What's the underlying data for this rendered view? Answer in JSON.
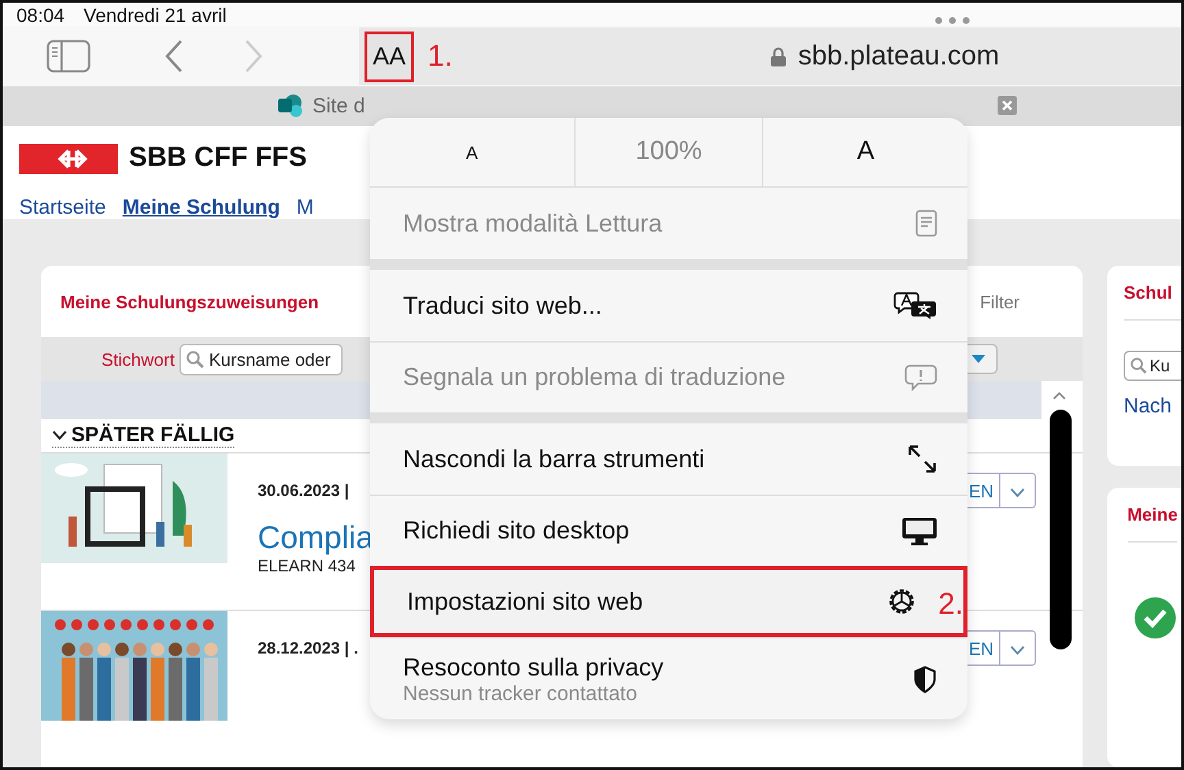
{
  "status_bar": {
    "time": "08:04",
    "date": "Vendredi 21 avril"
  },
  "toolbar": {
    "text_size_button": {
      "label": "AA",
      "annotation": "1.",
      "highlighted": true
    },
    "address": "sbb.plateau.com"
  },
  "tab": {
    "title": "Site d"
  },
  "site": {
    "logo": "SBB CFF FFS",
    "nav": [
      {
        "label": "Startseite",
        "selected": false
      },
      {
        "label": "Meine Schulung",
        "selected": true
      },
      {
        "label": "M",
        "selected": false
      }
    ]
  },
  "assignments": {
    "title": "Meine Schulungszuweisungen",
    "filter": "Filter",
    "keyword_label": "Stichwort",
    "search_placeholder": "Kursname oder",
    "section": "SPÄTER FÄLLIG",
    "courses": [
      {
        "date": "30.06.2023 |",
        "title": "Complia",
        "code": "ELEARN 434",
        "action": "EN"
      },
      {
        "date": "28.12.2023 | .",
        "action": "EN"
      }
    ]
  },
  "side_panels": [
    {
      "kind": "search",
      "title": "Schul",
      "search_placeholder": "Ku",
      "link": "Nach"
    },
    {
      "kind": "status",
      "title": "Meine"
    }
  ],
  "menu": {
    "text_size": {
      "smaller": "A",
      "zoom": "100%",
      "larger": "A"
    },
    "groups": [
      [
        {
          "label": "Mostra modalità Lettura",
          "disabled": true,
          "highlighted": false
        }
      ],
      [
        {
          "label": "Traduci sito web...",
          "disabled": false,
          "highlighted": false
        },
        {
          "label": "Segnala un problema di traduzione",
          "disabled": true,
          "highlighted": false
        }
      ],
      [
        {
          "label": "Nascondi la barra strumenti",
          "disabled": false,
          "highlighted": false
        },
        {
          "label": "Richiedi sito desktop",
          "disabled": false,
          "highlighted": false
        },
        {
          "label": "Impostazioni sito web",
          "disabled": false,
          "highlighted": true,
          "annotation": "2."
        },
        {
          "label": "Resoconto sulla privacy",
          "subtitle": "Nessun tracker contattato",
          "disabled": false,
          "highlighted": false
        }
      ]
    ]
  }
}
